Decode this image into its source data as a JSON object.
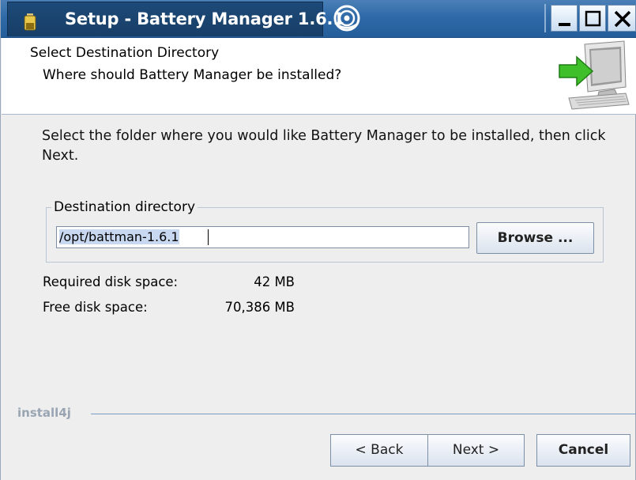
{
  "window": {
    "title": "Setup - Battery Manager 1.6.1",
    "icons": [
      "battery-icon",
      "distro-logo-icon",
      "minimize-icon",
      "maximize-icon",
      "close-icon"
    ]
  },
  "header": {
    "title": "Select Destination Directory",
    "subtitle": "Where should Battery Manager be installed?",
    "graphic": "computer-with-arrow-icon"
  },
  "body": {
    "instruction": "Select the folder where you would like Battery Manager to be installed, then click Next.",
    "group_label": "Destination directory",
    "directory_value": "/opt/battman-1.6.1",
    "browse_label": "Browse ...",
    "required_label": "Required disk space:",
    "required_value": "42 MB",
    "free_label": "Free disk space:",
    "free_value": "70,386 MB"
  },
  "footer": {
    "brand": "install4j",
    "back_label": "< Back",
    "next_label": "Next >",
    "cancel_label": "Cancel"
  },
  "colors": {
    "titlebar": "#2f6aa8",
    "title_tab": "#1d4a79",
    "dialog_bg": "#eeeeee",
    "accent_arrow": "#3fbf2a"
  }
}
